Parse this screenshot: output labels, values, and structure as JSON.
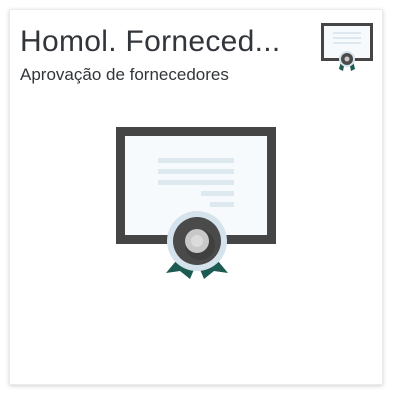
{
  "tile": {
    "title": "Homol. Forneced...",
    "subtitle": "Aprovação de fornecedores",
    "header_icon": "certificate-icon",
    "illustration": "certificate-illustration"
  },
  "colors": {
    "frame": "#454545",
    "paper": "#f7fafc",
    "paper_lines": "#dde8ef",
    "seal_outer": "#d5e3ec",
    "seal_dark": "#4a4a4a",
    "seal_light": "#c8c8c8",
    "ribbon": "#1d5a52",
    "text": "#32363a"
  }
}
